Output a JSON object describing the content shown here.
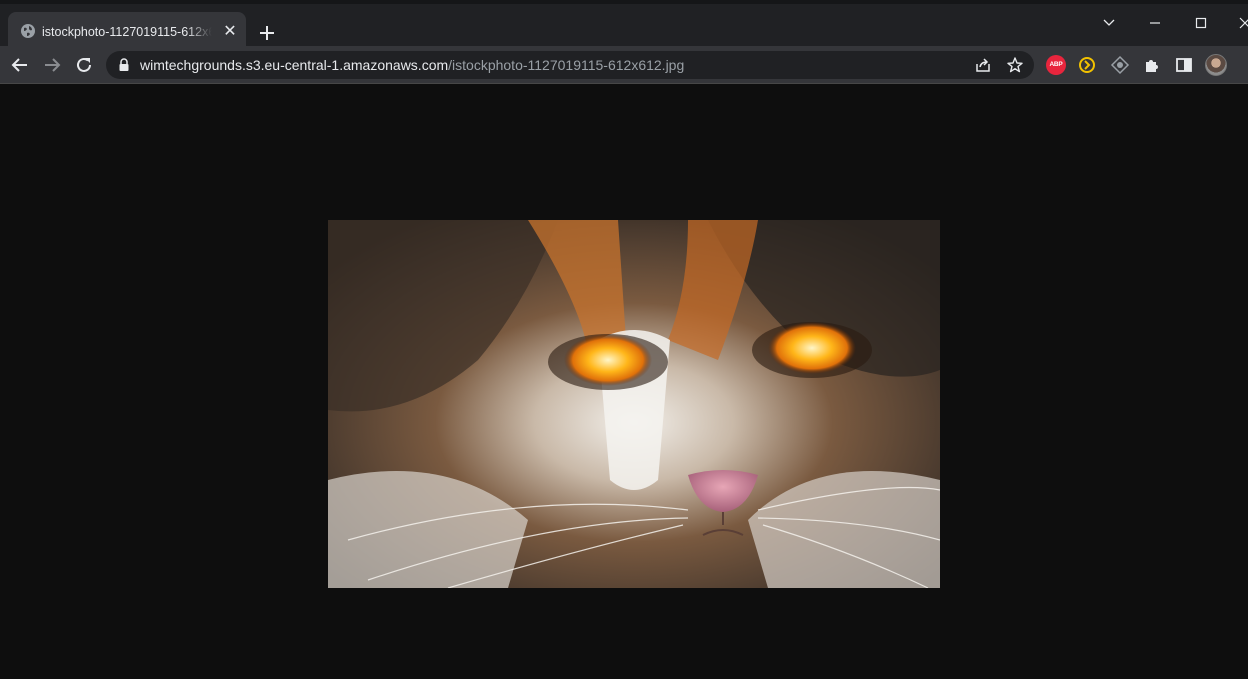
{
  "tab": {
    "title": "istockphoto-1127019115-612x612.jpg",
    "close_label": "✕"
  },
  "address_bar": {
    "host": "wimtechgrounds.s3.eu-central-1.amazonaws.com",
    "path": "/istockphoto-1127019115-612x612.jpg"
  },
  "extensions": {
    "abp_label": "ABP"
  },
  "colors": {
    "titlebar": "#202124",
    "toolbar": "#35363a",
    "viewer_background": "#0e0e0e"
  },
  "icons": [
    "globe-icon",
    "close-icon",
    "plus-icon",
    "chevron-down-icon",
    "minimize-icon",
    "maximize-icon",
    "window-close-icon",
    "back-arrow-icon",
    "forward-arrow-icon",
    "reload-icon",
    "lock-icon",
    "share-icon",
    "star-icon",
    "adblock-icon",
    "extension-icon",
    "puzzle-icon",
    "side-panel-icon",
    "avatar"
  ]
}
